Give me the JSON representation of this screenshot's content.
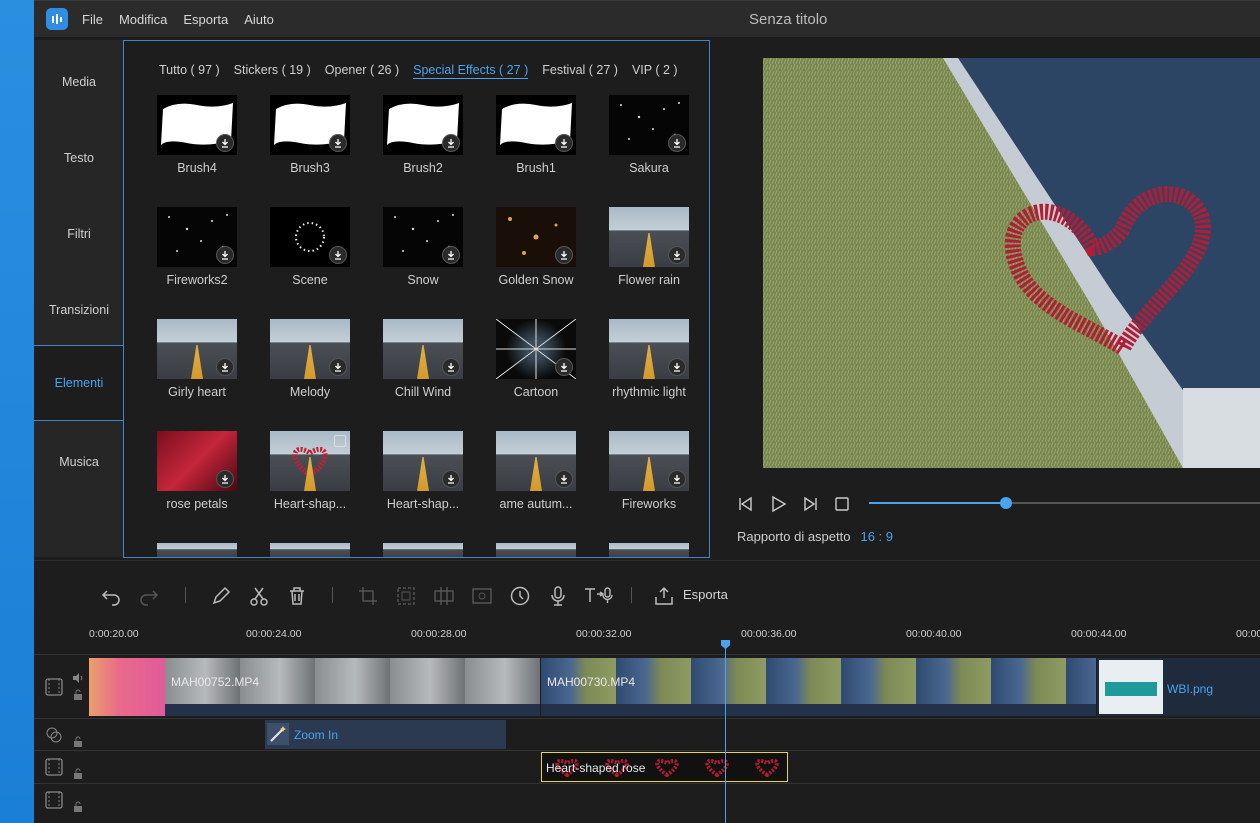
{
  "titlebar": {
    "menu": [
      "File",
      "Modifica",
      "Esporta",
      "Aiuto"
    ],
    "title": "Senza titolo"
  },
  "leftnav": {
    "items": [
      {
        "label": "Media",
        "active": false
      },
      {
        "label": "Testo",
        "active": false
      },
      {
        "label": "Filtri",
        "active": false
      },
      {
        "label": "Transizioni",
        "active": false
      },
      {
        "label": "Elementi",
        "active": true
      },
      {
        "label": "Musica",
        "active": false
      }
    ]
  },
  "panel": {
    "tabs": [
      {
        "label": "Tutto ( 97 )",
        "active": false
      },
      {
        "label": "Stickers ( 19 )",
        "active": false
      },
      {
        "label": "Opener ( 26 )",
        "active": false
      },
      {
        "label": "Special Effects ( 27 )",
        "active": true
      },
      {
        "label": "Festival ( 27 )",
        "active": false
      },
      {
        "label": "VIP ( 2 )",
        "active": false
      }
    ],
    "effects": [
      {
        "label": "Brush4",
        "style": "brush"
      },
      {
        "label": "Brush3",
        "style": "brush"
      },
      {
        "label": "Brush2",
        "style": "brush"
      },
      {
        "label": "Brush1",
        "style": "brush"
      },
      {
        "label": "Sakura",
        "style": "dark"
      },
      {
        "label": "Fireworks2",
        "style": "dark"
      },
      {
        "label": "Scene",
        "style": "ring"
      },
      {
        "label": "Snow",
        "style": "dark"
      },
      {
        "label": "Golden Snow",
        "style": "golden"
      },
      {
        "label": "Flower rain",
        "style": "road"
      },
      {
        "label": "Girly heart",
        "style": "road"
      },
      {
        "label": "Melody",
        "style": "road"
      },
      {
        "label": "Chill Wind",
        "style": "road"
      },
      {
        "label": "Cartoon",
        "style": "cartoon"
      },
      {
        "label": "rhythmic light",
        "style": "road"
      },
      {
        "label": "rose petals",
        "style": "rose"
      },
      {
        "label": "Heart-shap...",
        "style": "heartroad"
      },
      {
        "label": "Heart-shap...",
        "style": "road"
      },
      {
        "label": "ame autum...",
        "style": "road"
      },
      {
        "label": "Fireworks",
        "style": "road"
      }
    ]
  },
  "preview": {
    "aspect_label": "Rapporto di aspetto",
    "aspect_value": "16 : 9",
    "progress": 0.35
  },
  "toolbar": {
    "export_label": "Esporta",
    "icons": [
      "undo-icon",
      "redo-icon",
      "pencil-icon",
      "scissors-icon",
      "trash-icon",
      "crop-icon",
      "mosaic-icon",
      "freeze-icon",
      "zoom-icon",
      "clock-icon",
      "microphone-icon",
      "text-to-speech-icon",
      "export-icon"
    ]
  },
  "timeline": {
    "ruler": [
      "0:00:20.00",
      "00:00:24.00",
      "00:00:28.00",
      "00:00:32.00",
      "00:00:36.00",
      "00:00:40.00",
      "00:00:44.00",
      "00:00"
    ],
    "clips": {
      "video1": "MAH00752.MP4",
      "video2": "MAH00730.MP4",
      "image": "WBI.png",
      "effect": "Zoom In",
      "element": "Heart-shaped rose"
    }
  },
  "colors": {
    "accent": "#4aa3f0",
    "panel_border": "#3f86c8",
    "background": "#1d1d1d"
  }
}
